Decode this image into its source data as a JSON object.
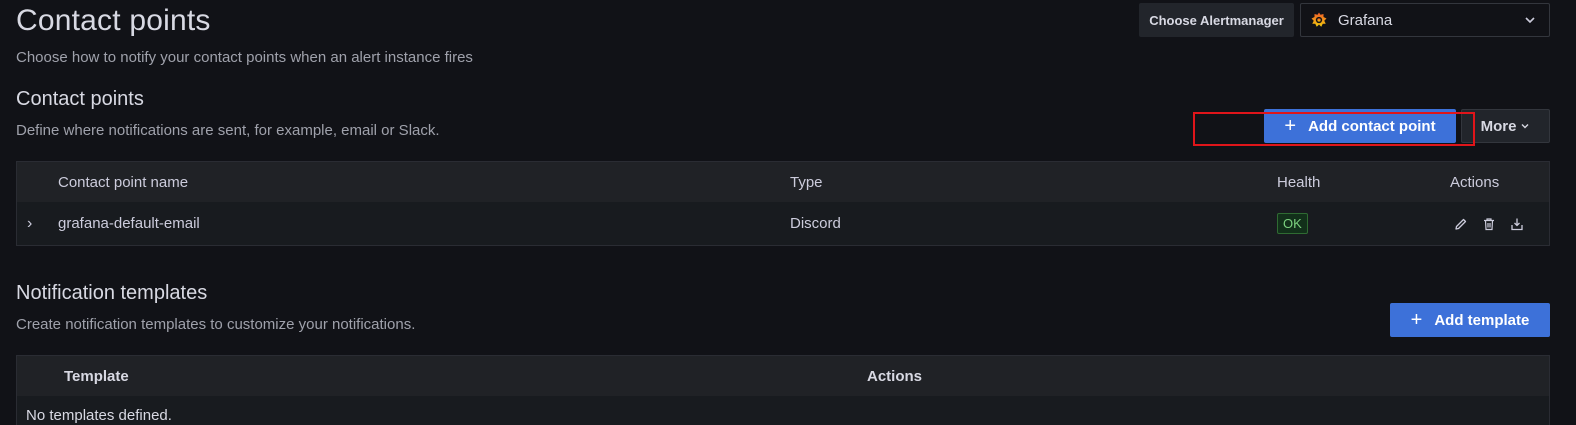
{
  "header": {
    "title": "Contact points",
    "subtitle": "Choose how to notify your contact points when an alert instance fires",
    "alertmanager_label": "Choose Alertmanager",
    "alertmanager_value": "Grafana",
    "alertmanager_icon": "grafana-logo-icon"
  },
  "contact_points": {
    "title": "Contact points",
    "description": "Define where notifications are sent, for example, email or Slack.",
    "add_label": "Add contact point",
    "more_label": "More",
    "columns": [
      "Contact point name",
      "Type",
      "Health",
      "Actions"
    ],
    "rows": [
      {
        "name": "grafana-default-email",
        "type": "Discord",
        "health": "OK",
        "actions": [
          "edit-icon",
          "delete-icon",
          "export-icon"
        ]
      }
    ]
  },
  "templates": {
    "title": "Notification templates",
    "description": "Create notification templates to customize your notifications.",
    "add_label": "Add template",
    "columns": [
      "Template",
      "Actions"
    ],
    "empty_text": "No templates defined."
  },
  "colors": {
    "background": "#111217",
    "primary": "#3d71d9",
    "ok_badge": "#7cd17f",
    "highlight": "#e0151a"
  }
}
